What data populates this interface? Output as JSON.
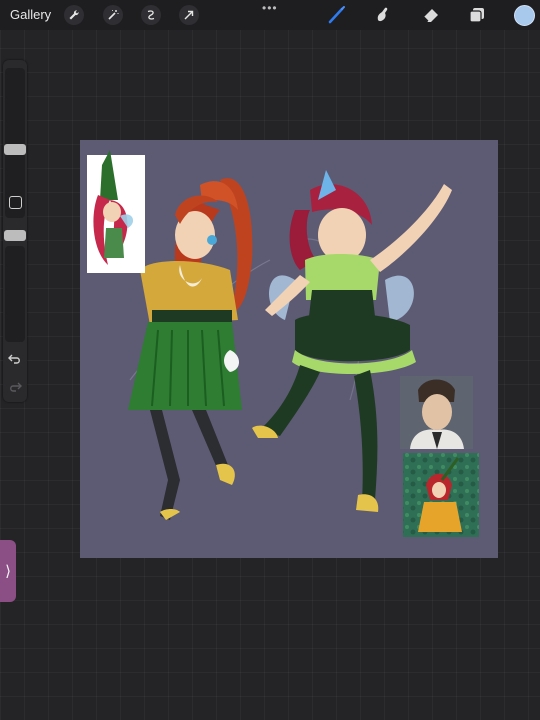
{
  "toolbar": {
    "gallery_label": "Gallery",
    "left_tools": [
      "wrench-icon",
      "magic-wand-icon",
      "selection-icon",
      "transform-arrow-icon"
    ],
    "right_tools": [
      "brush-icon",
      "smudge-icon",
      "eraser-icon",
      "layers-icon"
    ],
    "active_tool": "brush-icon",
    "current_color": "#a8c8ec"
  },
  "sidebar": {
    "controls": [
      "brush-size-slider",
      "modify-button",
      "opacity-slider",
      "undo-icon",
      "redo-icon"
    ]
  },
  "canvas": {
    "background": "#5d5b74",
    "references": [
      "reference-fairy-illustration",
      "reference-portrait-man",
      "reference-fairy-painting"
    ]
  },
  "colors": {
    "hair_red": "#c0431f",
    "skirt_green": "#2e7d32",
    "top_yellow": "#d4a83a",
    "fairy_green": "#a6d96a",
    "dark_green": "#1f3a22",
    "wing_blue": "#aec8e3"
  }
}
